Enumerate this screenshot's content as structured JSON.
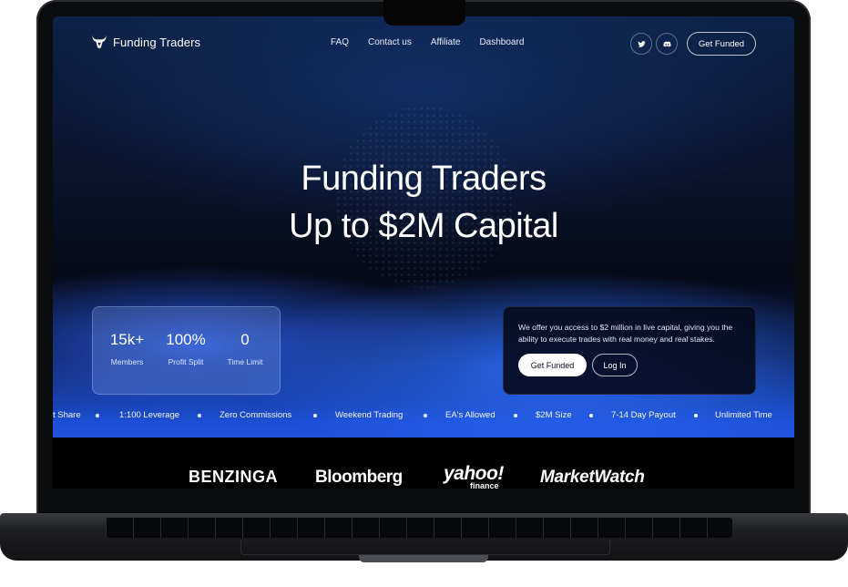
{
  "brand": {
    "name": "Funding Traders",
    "logo_icon": "bull-head-icon"
  },
  "nav": {
    "links": [
      "FAQ",
      "Contact us",
      "Affiliate",
      "Dashboard"
    ],
    "social_icons": [
      "twitter-icon",
      "discord-icon"
    ],
    "cta": "Get Funded"
  },
  "hero": {
    "line1": "Funding Traders",
    "line2": "Up to $2M Capital"
  },
  "stats": [
    {
      "value": "15k+",
      "label": "Members"
    },
    {
      "value": "100%",
      "label": "Profit Split"
    },
    {
      "value": "0",
      "label": "Time Limit"
    }
  ],
  "offer": {
    "text": "We offer you access to $2 million in live capital, giving you the ability to execute trades with real money and real stakes.",
    "primary_button": "Get Funded",
    "secondary_button": "Log In"
  },
  "ticker": [
    "t Share",
    "1:100 Leverage",
    "Zero Commissions",
    "Weekend Trading",
    "EA's Allowed",
    "$2M Size",
    "7-14 Day Payout",
    "Unlimited Time"
  ],
  "press": [
    "BENZINGA",
    "Bloomberg",
    "yahoo!",
    "finance",
    "MarketWatch"
  ],
  "colors": {
    "accent_blue": "#2a66f0",
    "dark_navy": "#060a18",
    "text_white": "#ffffff"
  }
}
